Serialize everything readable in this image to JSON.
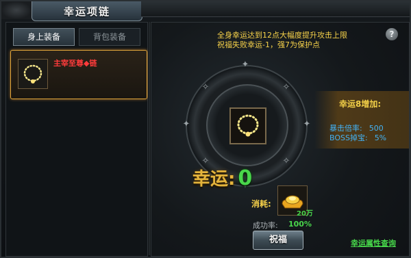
{
  "window": {
    "title": "幸运项链",
    "close_label": "✕"
  },
  "tabs": [
    {
      "label": "身上装备",
      "active": true
    },
    {
      "label": "背包装备",
      "active": false
    }
  ],
  "equipment": {
    "name": "主宰至尊◆链",
    "name_color": "#ff3b3b",
    "icon": "necklace-icon"
  },
  "info": {
    "line1": "全身幸运达到12点大幅度提升攻击上限",
    "line2": "祝福失败幸运-1，强7为保护点",
    "help_label": "?"
  },
  "luck": {
    "label": "幸运:",
    "value": "0"
  },
  "bonus": {
    "title": "幸运8增加:",
    "rows": [
      {
        "label": "暴击倍率:",
        "value": "500"
      },
      {
        "label": "BOSS掉宝:",
        "value": "5%"
      }
    ]
  },
  "cost": {
    "label": "消耗:",
    "amount": "20万",
    "icon": "gold-ingot-icon"
  },
  "success": {
    "label": "成功率:",
    "value": "100%"
  },
  "actions": {
    "bless_label": "祝福",
    "query_label": "幸运属性查询"
  },
  "colors": {
    "accent_gold": "#f7d24a",
    "success_green": "#49d64b",
    "bonus_blue": "#43b2f5"
  }
}
